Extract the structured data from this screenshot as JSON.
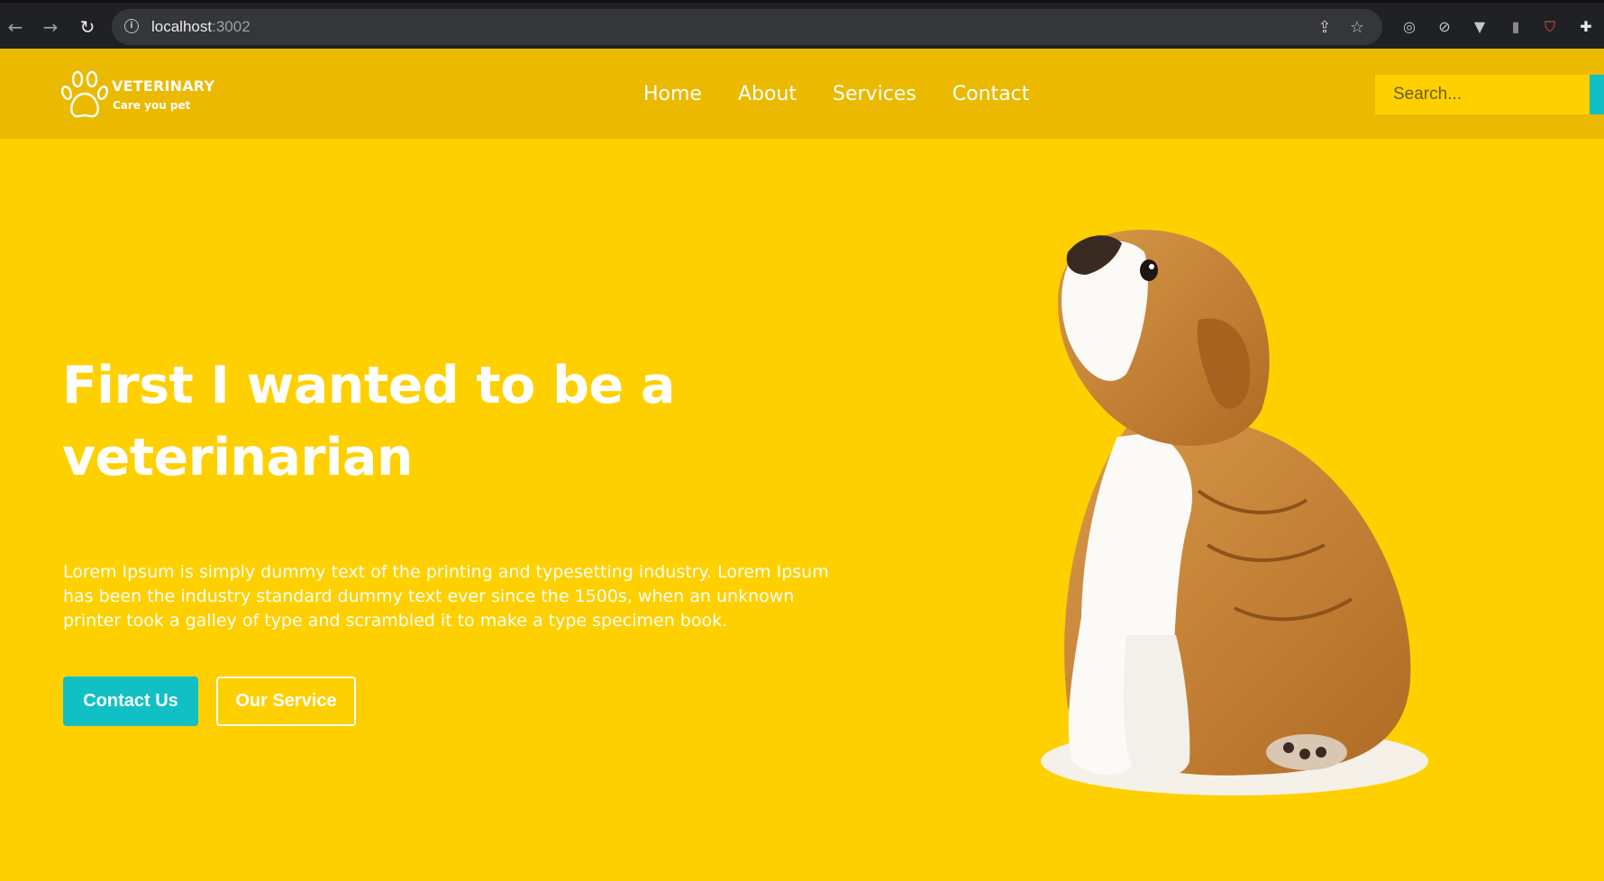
{
  "browser": {
    "url_host": "localhost",
    "url_port": ":3002",
    "icons": {
      "back": "back-arrow-icon",
      "forward": "forward-arrow-icon",
      "reload": "reload-icon",
      "info": "site-info-icon",
      "share": "share-icon",
      "bookmark": "bookmark-star-icon",
      "extensions": "puzzle-icon"
    }
  },
  "site": {
    "brand": {
      "title": "VETERINARY",
      "subtitle": "Care you pet",
      "icon": "paw-icon"
    },
    "nav": [
      {
        "label": "Home"
      },
      {
        "label": "About"
      },
      {
        "label": "Services"
      },
      {
        "label": "Contact"
      }
    ],
    "search": {
      "placeholder": "Search..."
    }
  },
  "hero": {
    "title": "First I wanted to be a veterinarian",
    "text": "Lorem Ipsum is simply dummy text of the printing and typesetting industry. Lorem Ipsum has been the industry standard dummy text ever since the 1500s, when an unknown printer took a galley of type and scrambled it to make a type specimen book.",
    "primary_button": "Contact Us",
    "secondary_button": "Our Service"
  },
  "colors": {
    "page_bg": "#ffd000",
    "header_bg": "#ebb900",
    "accent": "#10c0c4",
    "text": "#ffffff"
  }
}
